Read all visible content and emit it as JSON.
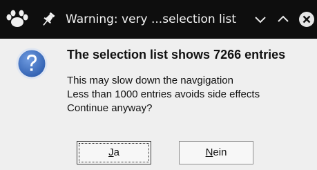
{
  "window": {
    "title": "Warning: very ...selection list",
    "app_icon": "paw-app-icon",
    "pin_icon": "pin-icon",
    "controls": {
      "minimize_icon": "chevron-down-icon",
      "maximize_icon": "chevron-up-icon",
      "close_icon": "close-circle-icon"
    }
  },
  "dialog": {
    "icon": "question-icon",
    "heading": "The selection list shows 7266 entries",
    "message_lines": [
      "This may slow down the navgigation",
      "Less than 1000 entries avoids side effects",
      "Continue anyway?"
    ],
    "buttons": {
      "yes": {
        "mnemonic": "J",
        "rest": "a",
        "full_label": "Ja"
      },
      "no": {
        "mnemonic": "N",
        "rest": "ein",
        "full_label": "Nein"
      }
    }
  },
  "colors": {
    "titlebar_bg": "#0e0e0e",
    "dialog_bg": "#efefef",
    "question_icon_blue": "#3d6fc2"
  }
}
